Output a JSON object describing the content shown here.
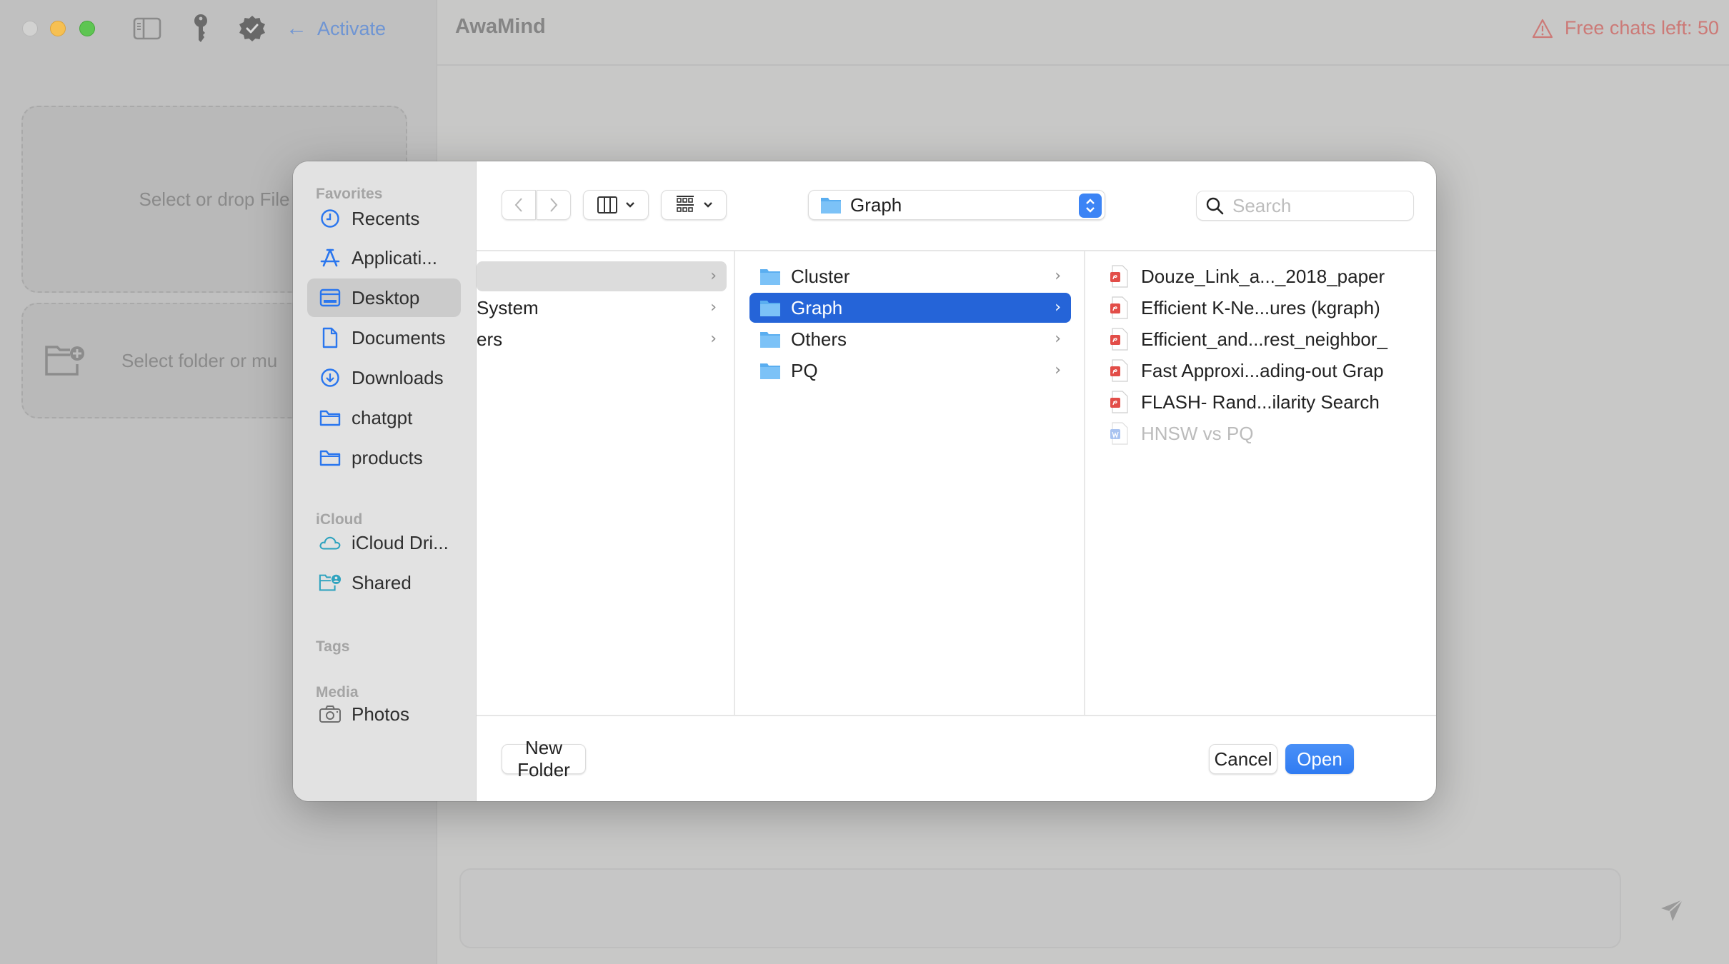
{
  "window": {
    "title": "AwaMind",
    "activate_label": "Activate",
    "free_chats_label": "Free chats left: 50",
    "colors": {
      "accent": "#6f95d3",
      "warning": "#cc7a77"
    }
  },
  "toolbar_icons": [
    "sidebar-toggle-icon",
    "key-icon",
    "verified-badge-icon"
  ],
  "sidebar": {
    "drop_files_label": "Select or drop File",
    "select_folder_label": "Select folder or mu"
  },
  "chat": {
    "input_placeholder": ""
  },
  "dialog": {
    "sidebar": {
      "sections": {
        "favorites": "Favorites",
        "icloud": "iCloud",
        "tags": "Tags",
        "media": "Media"
      },
      "favorites": [
        {
          "label": "Recents",
          "icon": "clock-icon"
        },
        {
          "label": "Applicati...",
          "icon": "app-store-icon"
        },
        {
          "label": "Desktop",
          "icon": "desktop-icon",
          "selected": true
        },
        {
          "label": "Documents",
          "icon": "document-icon"
        },
        {
          "label": "Downloads",
          "icon": "download-icon"
        },
        {
          "label": "chatgpt",
          "icon": "folder-icon"
        },
        {
          "label": "products",
          "icon": "folder-icon"
        }
      ],
      "icloud": [
        {
          "label": "iCloud Dri...",
          "icon": "cloud-icon"
        },
        {
          "label": "Shared",
          "icon": "shared-folder-icon"
        }
      ],
      "media": [
        {
          "label": "Photos",
          "icon": "camera-icon"
        }
      ]
    },
    "toolbar": {
      "current_folder": "Graph",
      "search_placeholder": "Search",
      "search_value": ""
    },
    "columns": {
      "col1": [
        {
          "label": "",
          "selected": true
        },
        {
          "label": "System"
        },
        {
          "label": "ers"
        }
      ],
      "col2": [
        {
          "label": "Cluster"
        },
        {
          "label": "Graph",
          "selected": true
        },
        {
          "label": "Others"
        },
        {
          "label": "PQ"
        }
      ],
      "col3": [
        {
          "label": "Douze_Link_a..._2018_paper",
          "type": "pdf"
        },
        {
          "label": "Efficient K-Ne...ures (kgraph)",
          "type": "pdf"
        },
        {
          "label": "Efficient_and...rest_neighbor_",
          "type": "pdf"
        },
        {
          "label": "Fast Approxi...ading-out Grap",
          "type": "pdf"
        },
        {
          "label": "FLASH- Rand...ilarity Search",
          "type": "pdf"
        },
        {
          "label": "HNSW vs PQ",
          "type": "word",
          "disabled": true
        }
      ]
    },
    "footer": {
      "new_folder_label": "New Folder",
      "cancel_label": "Cancel",
      "open_label": "Open"
    },
    "colors": {
      "selection": "#2564d8",
      "primary_button": "#3a86f5"
    }
  }
}
